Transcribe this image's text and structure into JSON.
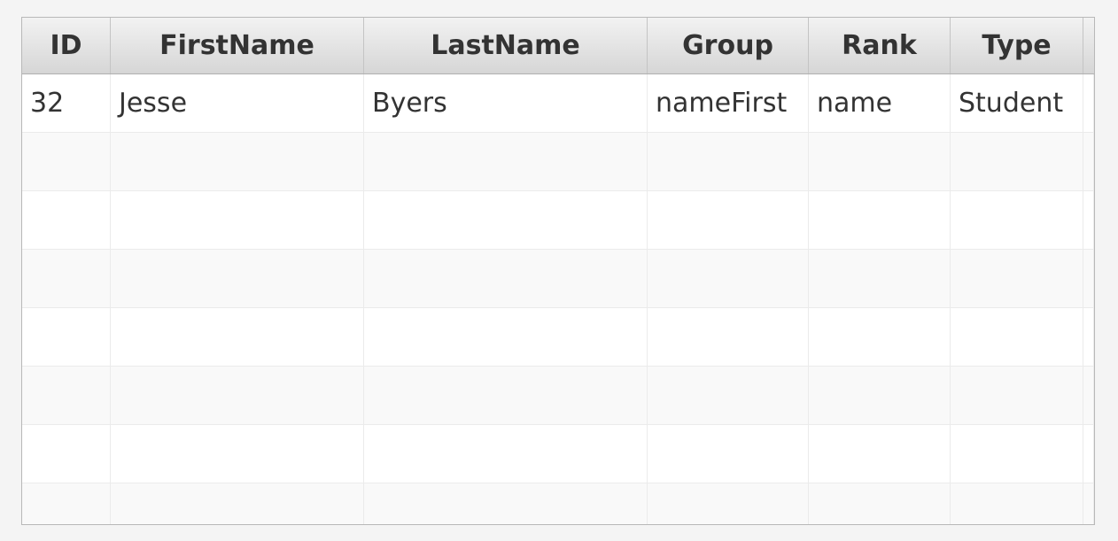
{
  "table": {
    "columns": [
      "ID",
      "FirstName",
      "LastName",
      "Group",
      "Rank",
      "Type"
    ],
    "rows": [
      [
        "32",
        "Jesse",
        "Byers",
        "nameFirst",
        "name",
        "Student"
      ]
    ]
  }
}
